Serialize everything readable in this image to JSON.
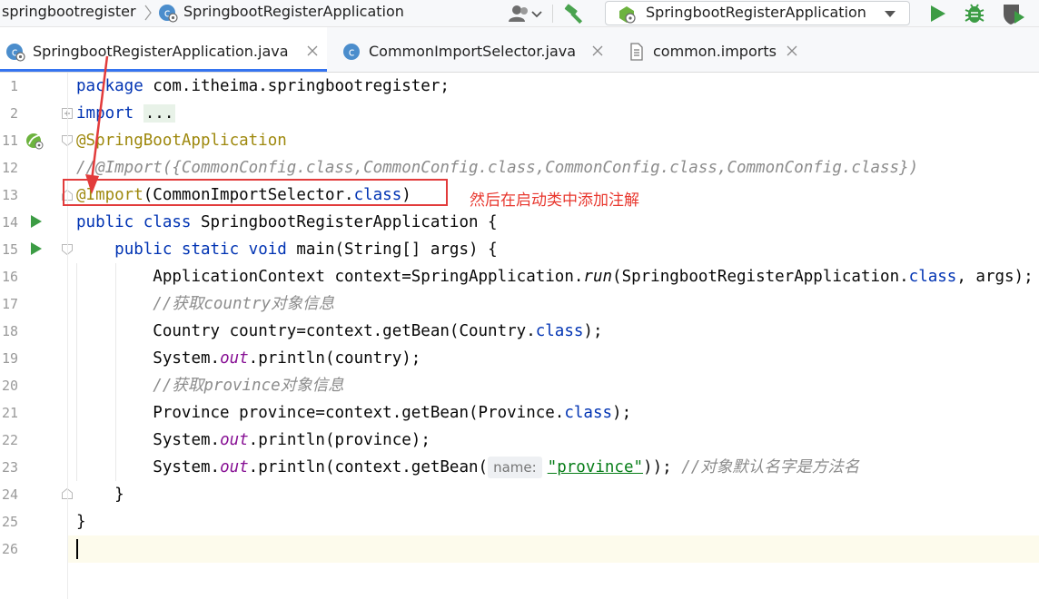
{
  "toolbar": {
    "project_name": "springbootregister",
    "class_name": "SpringbootRegisterApplication",
    "run_config_label": "SpringbootRegisterApplication"
  },
  "tabs": [
    {
      "label": "SpringbootRegisterApplication.java",
      "icon": "spring-class-icon",
      "active": true
    },
    {
      "label": "CommonImportSelector.java",
      "icon": "class-icon",
      "active": false
    },
    {
      "label": "common.imports",
      "icon": "file-icon",
      "active": false
    }
  ],
  "line_numbers": [
    "1",
    "2",
    "11",
    "12",
    "13",
    "14",
    "15",
    "16",
    "17",
    "18",
    "19",
    "20",
    "21",
    "22",
    "23",
    "24",
    "25",
    "26"
  ],
  "code": {
    "l1": {
      "kw": "package",
      "rest": " com.itheima.springbootregister;"
    },
    "l2": {
      "kw": "import",
      "placeholder": "..."
    },
    "l11": {
      "ann": "@SpringBootApplication"
    },
    "l12": {
      "text": "//@Import({CommonConfig.class,CommonConfig.class,CommonConfig.class,CommonConfig.class})"
    },
    "l13": {
      "ann": "@Import",
      "mid": "(CommonImportSelector.",
      "kw": "class",
      "end": ")"
    },
    "l14": {
      "kw": "public class",
      "rest": " SpringbootRegisterApplication {"
    },
    "l15": {
      "kw": "public static void",
      "rest": " main(String[] args) {"
    },
    "l16": {
      "a": "ApplicationContext context=SpringApplication.",
      "ital": "run",
      "b": "(SpringbootRegisterApplication.",
      "kw": "class",
      "c": ", args);"
    },
    "l17": {
      "text": "//获取country对象信息"
    },
    "l18": {
      "a": "Country country=context.getBean(Country.",
      "kw": "class",
      "b": ");"
    },
    "l19": {
      "a": "System.",
      "field": "out",
      "b": ".println(country);"
    },
    "l20": {
      "text": "//获取province对象信息"
    },
    "l21": {
      "a": "Province province=context.getBean(Province.",
      "kw": "class",
      "b": ");"
    },
    "l22": {
      "a": "System.",
      "field": "out",
      "b": ".println(province);"
    },
    "l23": {
      "a": "System.",
      "field": "out",
      "b": ".println(context.getBean(",
      "hint": "name:",
      "str": "\"province\"",
      "c": ")); ",
      "cmt": "//对象默认名字是方法名"
    },
    "l24": {
      "text": "}"
    },
    "l25": {
      "text": "}"
    }
  },
  "annotation_note": "然后在启动类中添加注解",
  "colors": {
    "keyword": "#0033b3",
    "annotation": "#9e880d",
    "comment": "#8c8c8c",
    "string": "#067d17",
    "highlight_red": "#e23b3b",
    "tab_active_underline": "#3574f0"
  }
}
